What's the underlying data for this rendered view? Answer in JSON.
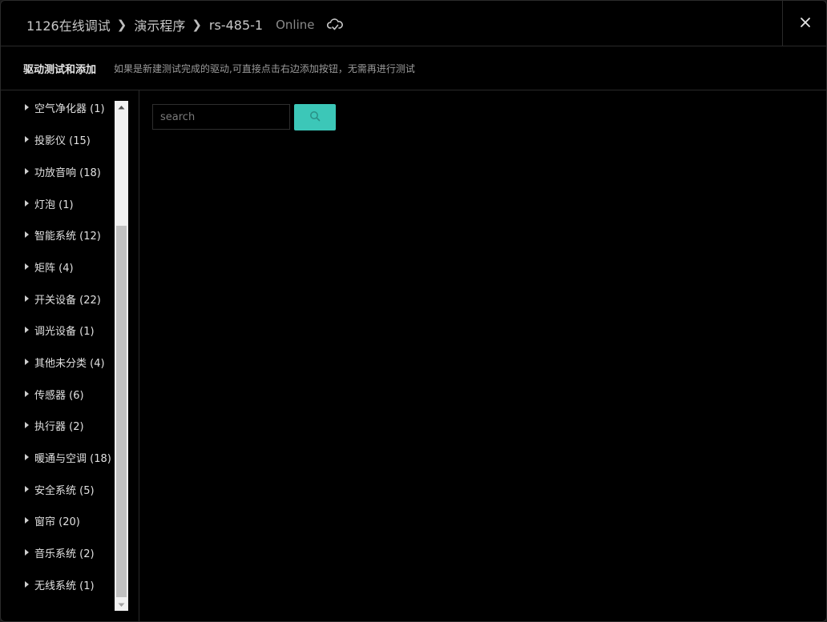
{
  "header": {
    "breadcrumbs": [
      "1126在线调试",
      "演示程序",
      "rs-485-1"
    ],
    "status": "Online",
    "cloud_icon": "cloud-check-icon",
    "close_icon": "close-icon"
  },
  "subbar": {
    "title": "驱动测试和添加",
    "description": "如果是新建测试完成的驱动,可直接点击右边添加按钮，无需再进行测试"
  },
  "sidebar": {
    "items": [
      {
        "label": "空气净化器 (1)"
      },
      {
        "label": "投影仪 (15)"
      },
      {
        "label": "功放音响 (18)"
      },
      {
        "label": "灯泡 (1)"
      },
      {
        "label": "智能系统 (12)"
      },
      {
        "label": "矩阵 (4)"
      },
      {
        "label": "开关设备 (22)"
      },
      {
        "label": "调光设备 (1)"
      },
      {
        "label": "其他未分类 (4)"
      },
      {
        "label": "传感器 (6)"
      },
      {
        "label": "执行器 (2)"
      },
      {
        "label": "暖通与空调 (18)"
      },
      {
        "label": "安全系统 (5)"
      },
      {
        "label": "窗帘 (20)"
      },
      {
        "label": "音乐系统 (2)"
      },
      {
        "label": "无线系统 (1)"
      }
    ]
  },
  "search": {
    "placeholder": "search",
    "value": "",
    "button_icon": "search-icon"
  },
  "colors": {
    "accent": "#3cc7b8",
    "background": "#000000",
    "border": "#2a2a2a"
  }
}
